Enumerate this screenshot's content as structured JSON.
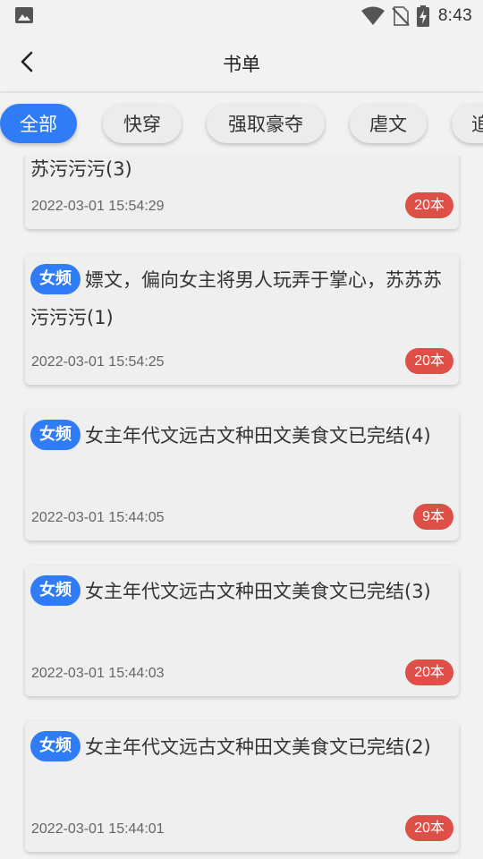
{
  "status_bar": {
    "time": "8:43",
    "icons": [
      "gallery-icon",
      "wifi-icon",
      "no-sim-icon",
      "battery-charging-icon"
    ]
  },
  "header": {
    "back_icon": "chevron-left-icon",
    "title": "书单"
  },
  "tabs": [
    {
      "label": "全部",
      "active": true
    },
    {
      "label": "快穿",
      "active": false
    },
    {
      "label": "强取豪夺",
      "active": false
    },
    {
      "label": "虐文",
      "active": false
    },
    {
      "label": "追",
      "active": false
    }
  ],
  "cards": [
    {
      "badge": "",
      "title_line2": "苏污污污(3)",
      "date": "2022-03-01 15:54:29",
      "count": "20本"
    },
    {
      "badge": "女频",
      "title": "嫖文，偏向女主将男人玩弄于掌心，苏苏苏污污污(1)",
      "date": "2022-03-01 15:54:25",
      "count": "20本"
    },
    {
      "badge": "女频",
      "title": "女主年代文远古文种田文美食文已完结(4)",
      "date": "2022-03-01 15:44:05",
      "count": "9本"
    },
    {
      "badge": "女频",
      "title": "女主年代文远古文种田文美食文已完结(3)",
      "date": "2022-03-01 15:44:03",
      "count": "20本"
    },
    {
      "badge": "女频",
      "title": "女主年代文远古文种田文美食文已完结(2)",
      "date": "2022-03-01 15:44:01",
      "count": "20本"
    }
  ],
  "colors": {
    "accent_blue": "#2f7cf6",
    "count_red": "#de4f48",
    "background": "#f2f2f2"
  }
}
